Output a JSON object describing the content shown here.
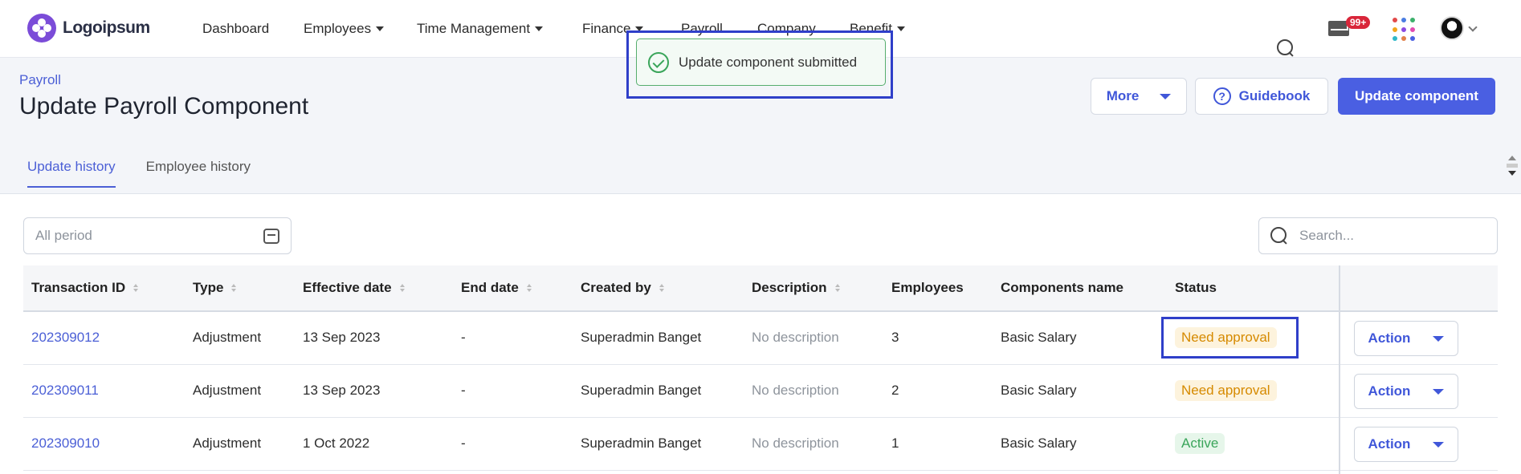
{
  "brand": {
    "name": "Logoipsum"
  },
  "nav": [
    {
      "label": "Dashboard",
      "caret": false
    },
    {
      "label": "Employees",
      "caret": true
    },
    {
      "label": "Time Management",
      "caret": true
    },
    {
      "label": "Finance",
      "caret": true
    },
    {
      "label": "Payroll",
      "caret": false
    },
    {
      "label": "Company",
      "caret": false
    },
    {
      "label": "Benefit",
      "caret": true
    }
  ],
  "notifications": {
    "badge": "99+"
  },
  "apps_colors": [
    "#e24a4a",
    "#4a7de2",
    "#3cb06b",
    "#f2a51a",
    "#8a4ae2",
    "#e24ab0",
    "#2fb8c8",
    "#e2814a",
    "#4a5fe2"
  ],
  "header": {
    "breadcrumb": "Payroll",
    "title": "Update Payroll Component",
    "buttons": {
      "more": "More",
      "guidebook": "Guidebook",
      "update": "Update component"
    }
  },
  "tabs": [
    {
      "label": "Update history",
      "active": true
    },
    {
      "label": "Employee history",
      "active": false
    }
  ],
  "filters": {
    "period_placeholder": "All period",
    "search_placeholder": "Search..."
  },
  "toast": {
    "message": "Update component submitted"
  },
  "table": {
    "columns": [
      "Transaction ID",
      "Type",
      "Effective date",
      "End date",
      "Created by",
      "Description",
      "Employees",
      "Components name",
      "Status"
    ],
    "rows": [
      {
        "id": "202309012",
        "type": "Adjustment",
        "effective": "13 Sep 2023",
        "end": "-",
        "created_by": "Superadmin Banget",
        "description": "No description",
        "employees": "3",
        "component": "Basic Salary",
        "status": "Need approval",
        "status_kind": "warn",
        "action": "Action"
      },
      {
        "id": "202309011",
        "type": "Adjustment",
        "effective": "13 Sep 2023",
        "end": "-",
        "created_by": "Superadmin Banget",
        "description": "No description",
        "employees": "2",
        "component": "Basic Salary",
        "status": "Need approval",
        "status_kind": "warn",
        "action": "Action"
      },
      {
        "id": "202309010",
        "type": "Adjustment",
        "effective": "1 Oct 2022",
        "end": "-",
        "created_by": "Superadmin Banget",
        "description": "No description",
        "employees": "1",
        "component": "Basic Salary",
        "status": "Active",
        "status_kind": "ok",
        "action": "Action"
      }
    ]
  },
  "colors": {
    "accent": "#4a5fe2",
    "highlight": "#2f3fc9"
  }
}
